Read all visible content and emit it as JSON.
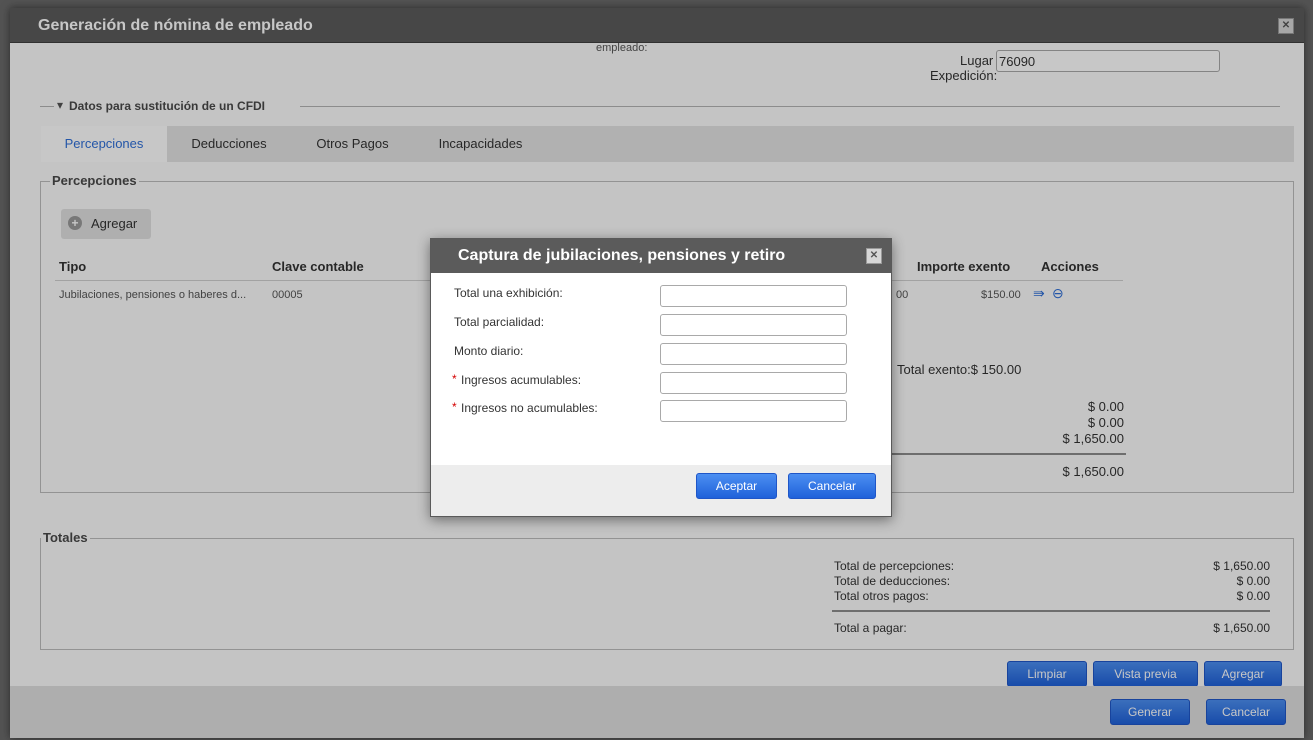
{
  "window": {
    "title": "Generación de nómina de empleado"
  },
  "top": {
    "empleado_label": "empleado:",
    "lugar_label_1": "Lugar",
    "lugar_label_2": "Expedición:",
    "lugar_value": "76090"
  },
  "cfdi_section": {
    "label": "Datos para sustitución de un CFDI"
  },
  "tabs": [
    {
      "label": "Percepciones"
    },
    {
      "label": "Deducciones"
    },
    {
      "label": "Otros Pagos"
    },
    {
      "label": "Incapacidades"
    }
  ],
  "percepciones": {
    "legend": "Percepciones",
    "add_button": "Agregar",
    "columns": {
      "tipo": "Tipo",
      "clave": "Clave contable",
      "importe_exento": "Importe exento",
      "acciones": "Acciones"
    },
    "row": {
      "tipo": "Jubilaciones, pensiones o haberes d...",
      "clave": "00005",
      "gravado_partial": "00",
      "exento": "$150.00"
    },
    "total_exento": "Total exento:$ 150.00",
    "sum_lines": [
      "$ 0.00",
      "$ 0.00",
      "$ 1,650.00"
    ],
    "sum_total": "$ 1,650.00"
  },
  "totales": {
    "legend": "Totales",
    "rows": [
      {
        "label": "Total de percepciones:",
        "value": "$ 1,650.00"
      },
      {
        "label": "Total de deducciones:",
        "value": "$ 0.00"
      },
      {
        "label": "Total otros pagos:",
        "value": "$ 0.00"
      }
    ],
    "total_label": "Total a pagar:",
    "total_value": "$ 1,650.00"
  },
  "actions": {
    "limpiar": "Limpiar",
    "vista_previa": "Vista previa",
    "agregar": "Agregar"
  },
  "footer": {
    "generar": "Generar",
    "cancelar": "Cancelar"
  },
  "modal": {
    "title": "Captura de jubilaciones, pensiones y retiro",
    "fields": [
      {
        "label": "Total una exhibición:",
        "required": false,
        "value": ""
      },
      {
        "label": "Total parcialidad:",
        "required": false,
        "value": ""
      },
      {
        "label": "Monto diario:",
        "required": false,
        "value": ""
      },
      {
        "label": "Ingresos acumulables:",
        "required": true,
        "value": ""
      },
      {
        "label": "Ingresos no acumulables:",
        "required": true,
        "value": ""
      }
    ],
    "required_mark": "*",
    "accept": "Aceptar",
    "cancel": "Cancelar"
  },
  "icons": {
    "collapse": "triangle-down-icon",
    "add": "plus-circle-icon",
    "edit": "edit-arrow-icon",
    "remove": "minus-circle-icon",
    "close": "close-icon"
  },
  "colors": {
    "accent": "#2f6fd8",
    "button": "#1f61da",
    "titlebar": "#5b5b5b"
  }
}
